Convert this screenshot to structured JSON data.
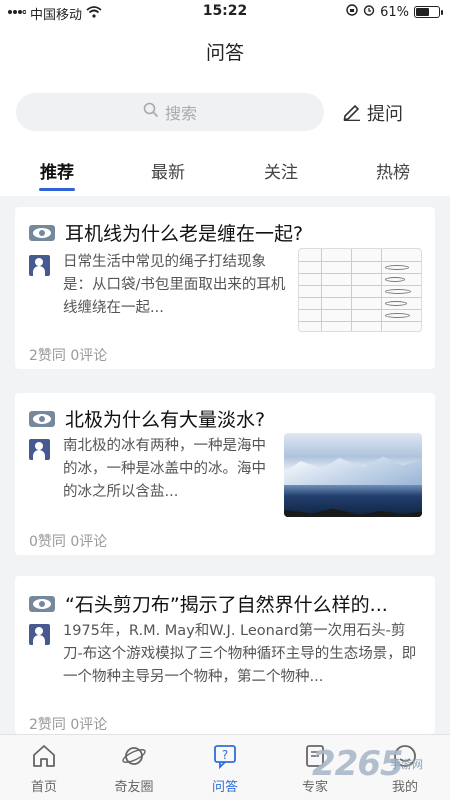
{
  "status_bar": {
    "carrier": "中国移动",
    "time": "15:22",
    "battery": "61%",
    "battery_level": 0.61
  },
  "header": {
    "title": "问答",
    "search_placeholder": "搜索",
    "ask_label": "提问"
  },
  "tabs": [
    {
      "label": "推荐",
      "active": true
    },
    {
      "label": "最新",
      "active": false
    },
    {
      "label": "关注",
      "active": false
    },
    {
      "label": "热榜",
      "active": false
    }
  ],
  "cards": [
    {
      "title": "耳机线为什么老是缠在一起?",
      "excerpt": "日常生活中常见的绳子打结现象是：从口袋/书包里面取出来的耳机线缠绕在一起...",
      "meta": "2赞同 0评论"
    },
    {
      "title": "北极为什么有大量淡水?",
      "excerpt": "南北极的冰有两种，一种是海中的冰，一种是冰盖中的冰。海中的冰之所以含盐...",
      "meta": "0赞同 0评论"
    },
    {
      "title": "“石头剪刀布”揭示了自然界什么样的...",
      "excerpt": "1975年，R.M. May和W.J. Leonard第一次用石头-剪刀-布这个游戏模拟了三个物种循环主导的生态场景，即一个物种主导另一个物种，第二个物种...",
      "meta": "2赞同 0评论"
    }
  ],
  "bottom_nav": [
    {
      "label": "首页",
      "icon": "home-icon"
    },
    {
      "label": "奇友圈",
      "icon": "planet-icon"
    },
    {
      "label": "问答",
      "icon": "qa-icon",
      "active": true
    },
    {
      "label": "专家",
      "icon": "expert-icon"
    },
    {
      "label": "我的",
      "icon": "profile-icon"
    }
  ],
  "watermark": {
    "number": "2265",
    "text": "手游网"
  },
  "colors": {
    "accent": "#2f63d8",
    "background": "#f2f3f5"
  }
}
